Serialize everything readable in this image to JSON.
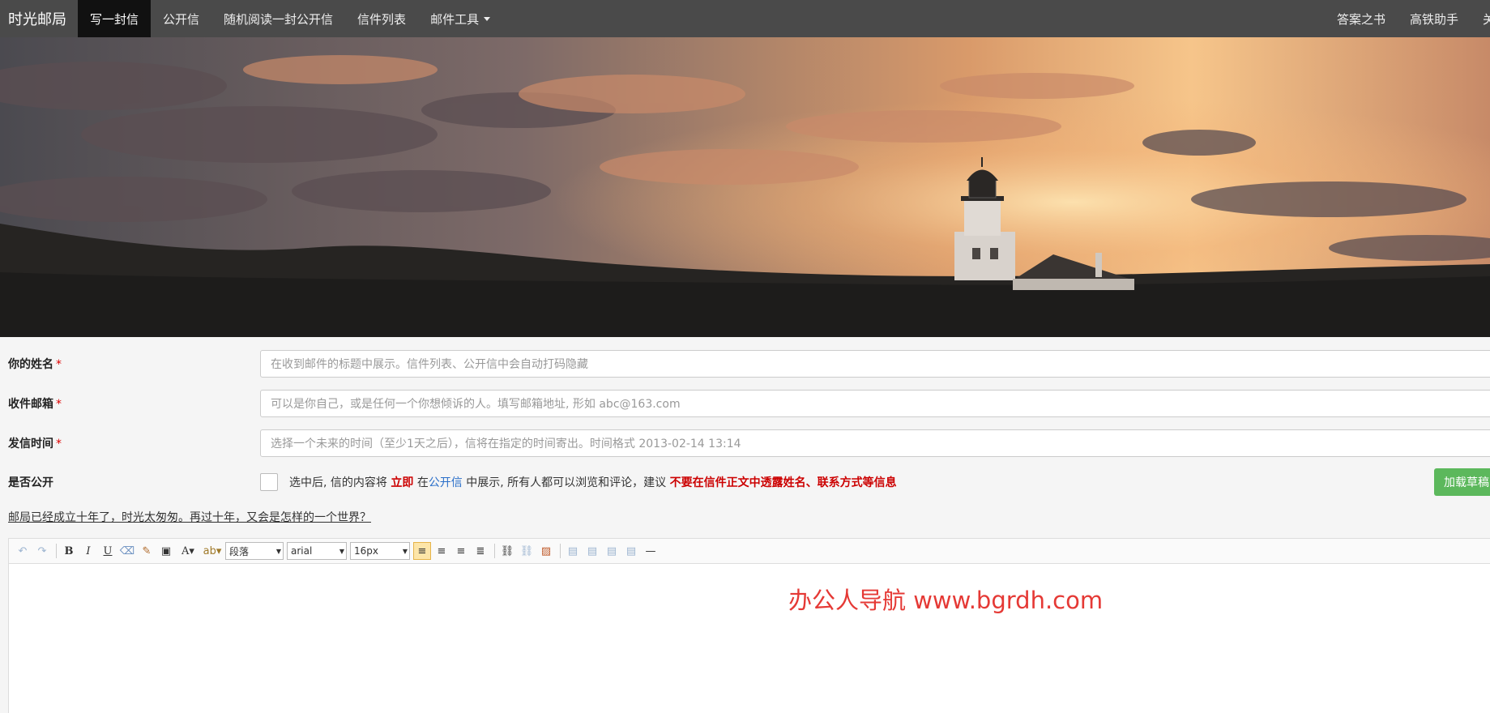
{
  "nav": {
    "brand": "时光邮局",
    "items": [
      {
        "label": "写一封信",
        "active": true
      },
      {
        "label": "公开信",
        "active": false
      },
      {
        "label": "随机阅读一封公开信",
        "active": false
      },
      {
        "label": "信件列表",
        "active": false
      },
      {
        "label": "邮件工具",
        "active": false,
        "dropdown": true
      }
    ],
    "right": [
      "答案之书",
      "高铁助手",
      "关"
    ]
  },
  "form": {
    "name": {
      "label": "你的姓名",
      "required": "*",
      "placeholder": "在收到邮件的标题中展示。信件列表、公开信中会自动打码隐藏"
    },
    "email": {
      "label": "收件邮箱",
      "required": "*",
      "placeholder": "可以是你自己，或是任何一个你想倾诉的人。填写邮箱地址, 形如 abc@163.com"
    },
    "time": {
      "label": "发信时间",
      "required": "*",
      "placeholder": "选择一个未来的时间（至少1天之后），信将在指定的时间寄出。时间格式 2013-02-14 13:14"
    },
    "public": {
      "label": "是否公开",
      "text1": "选中后, 信的内容将",
      "text2": "立即",
      "text3": "在",
      "text4": "公开信",
      "text5": "中展示, 所有人都可以浏览和评论，建议",
      "text6": "不要在信件正文中透露姓名、联系方式等信息"
    },
    "draft_button": "加载草稿"
  },
  "slogan": "邮局已经成立十年了，时光太匆匆。再过十年，又会是怎样的一个世界？",
  "toolbar": {
    "paragraph": "段落",
    "font": "arial",
    "size": "16px"
  },
  "watermark": "办公人导航 www.bgrdh.com",
  "colors": {
    "navbar": "#4a4a4a",
    "active_nav": "#111111",
    "required": "#dd0000",
    "link": "#2a6fc9",
    "success": "#5cb85c",
    "watermark": "#e53935"
  }
}
